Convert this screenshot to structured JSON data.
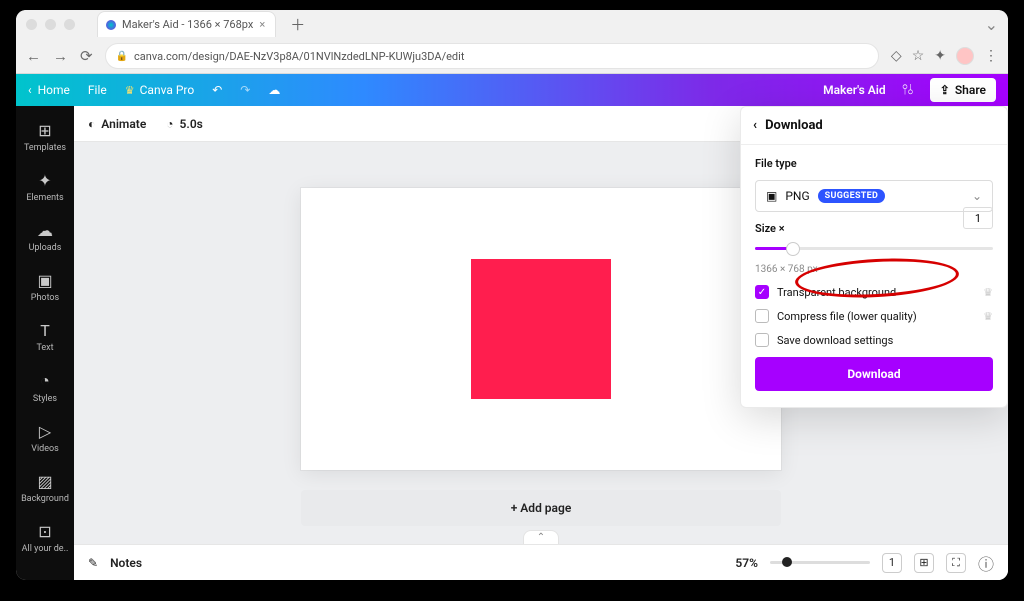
{
  "browser": {
    "tab_title": "Maker's Aid - 1366 × 768px",
    "url": "canva.com/design/DAE-NzV3p8A/01NVlNzdedLNP-KUWju3DA/edit"
  },
  "topbar": {
    "home": "Home",
    "file": "File",
    "canva_pro": "Canva Pro",
    "project_name": "Maker's Aid",
    "share": "Share"
  },
  "toolbar": {
    "animate": "Animate",
    "duration": "5.0s"
  },
  "sidebar": {
    "items": [
      {
        "label": "Templates",
        "icon": "⊞"
      },
      {
        "label": "Elements",
        "icon": "✦"
      },
      {
        "label": "Uploads",
        "icon": "☁"
      },
      {
        "label": "Photos",
        "icon": "▣"
      },
      {
        "label": "Text",
        "icon": "T"
      },
      {
        "label": "Styles",
        "icon": "◔"
      },
      {
        "label": "Videos",
        "icon": "▷"
      },
      {
        "label": "Background",
        "icon": "▨"
      },
      {
        "label": "All your de..",
        "icon": "⊡"
      }
    ]
  },
  "stage": {
    "add_page": "+ Add page"
  },
  "footer": {
    "notes": "Notes",
    "zoom_pct": "57%",
    "pager": "1"
  },
  "download": {
    "header": "Download",
    "file_type_label": "File type",
    "file_type_value": "PNG",
    "suggested": "SUGGESTED",
    "size_label": "Size ×",
    "size_value": "1",
    "dimensions": "1366 × 768 px",
    "opt_transparent": "Transparent background",
    "opt_compress": "Compress file (lower quality)",
    "opt_save": "Save download settings",
    "button": "Download"
  }
}
